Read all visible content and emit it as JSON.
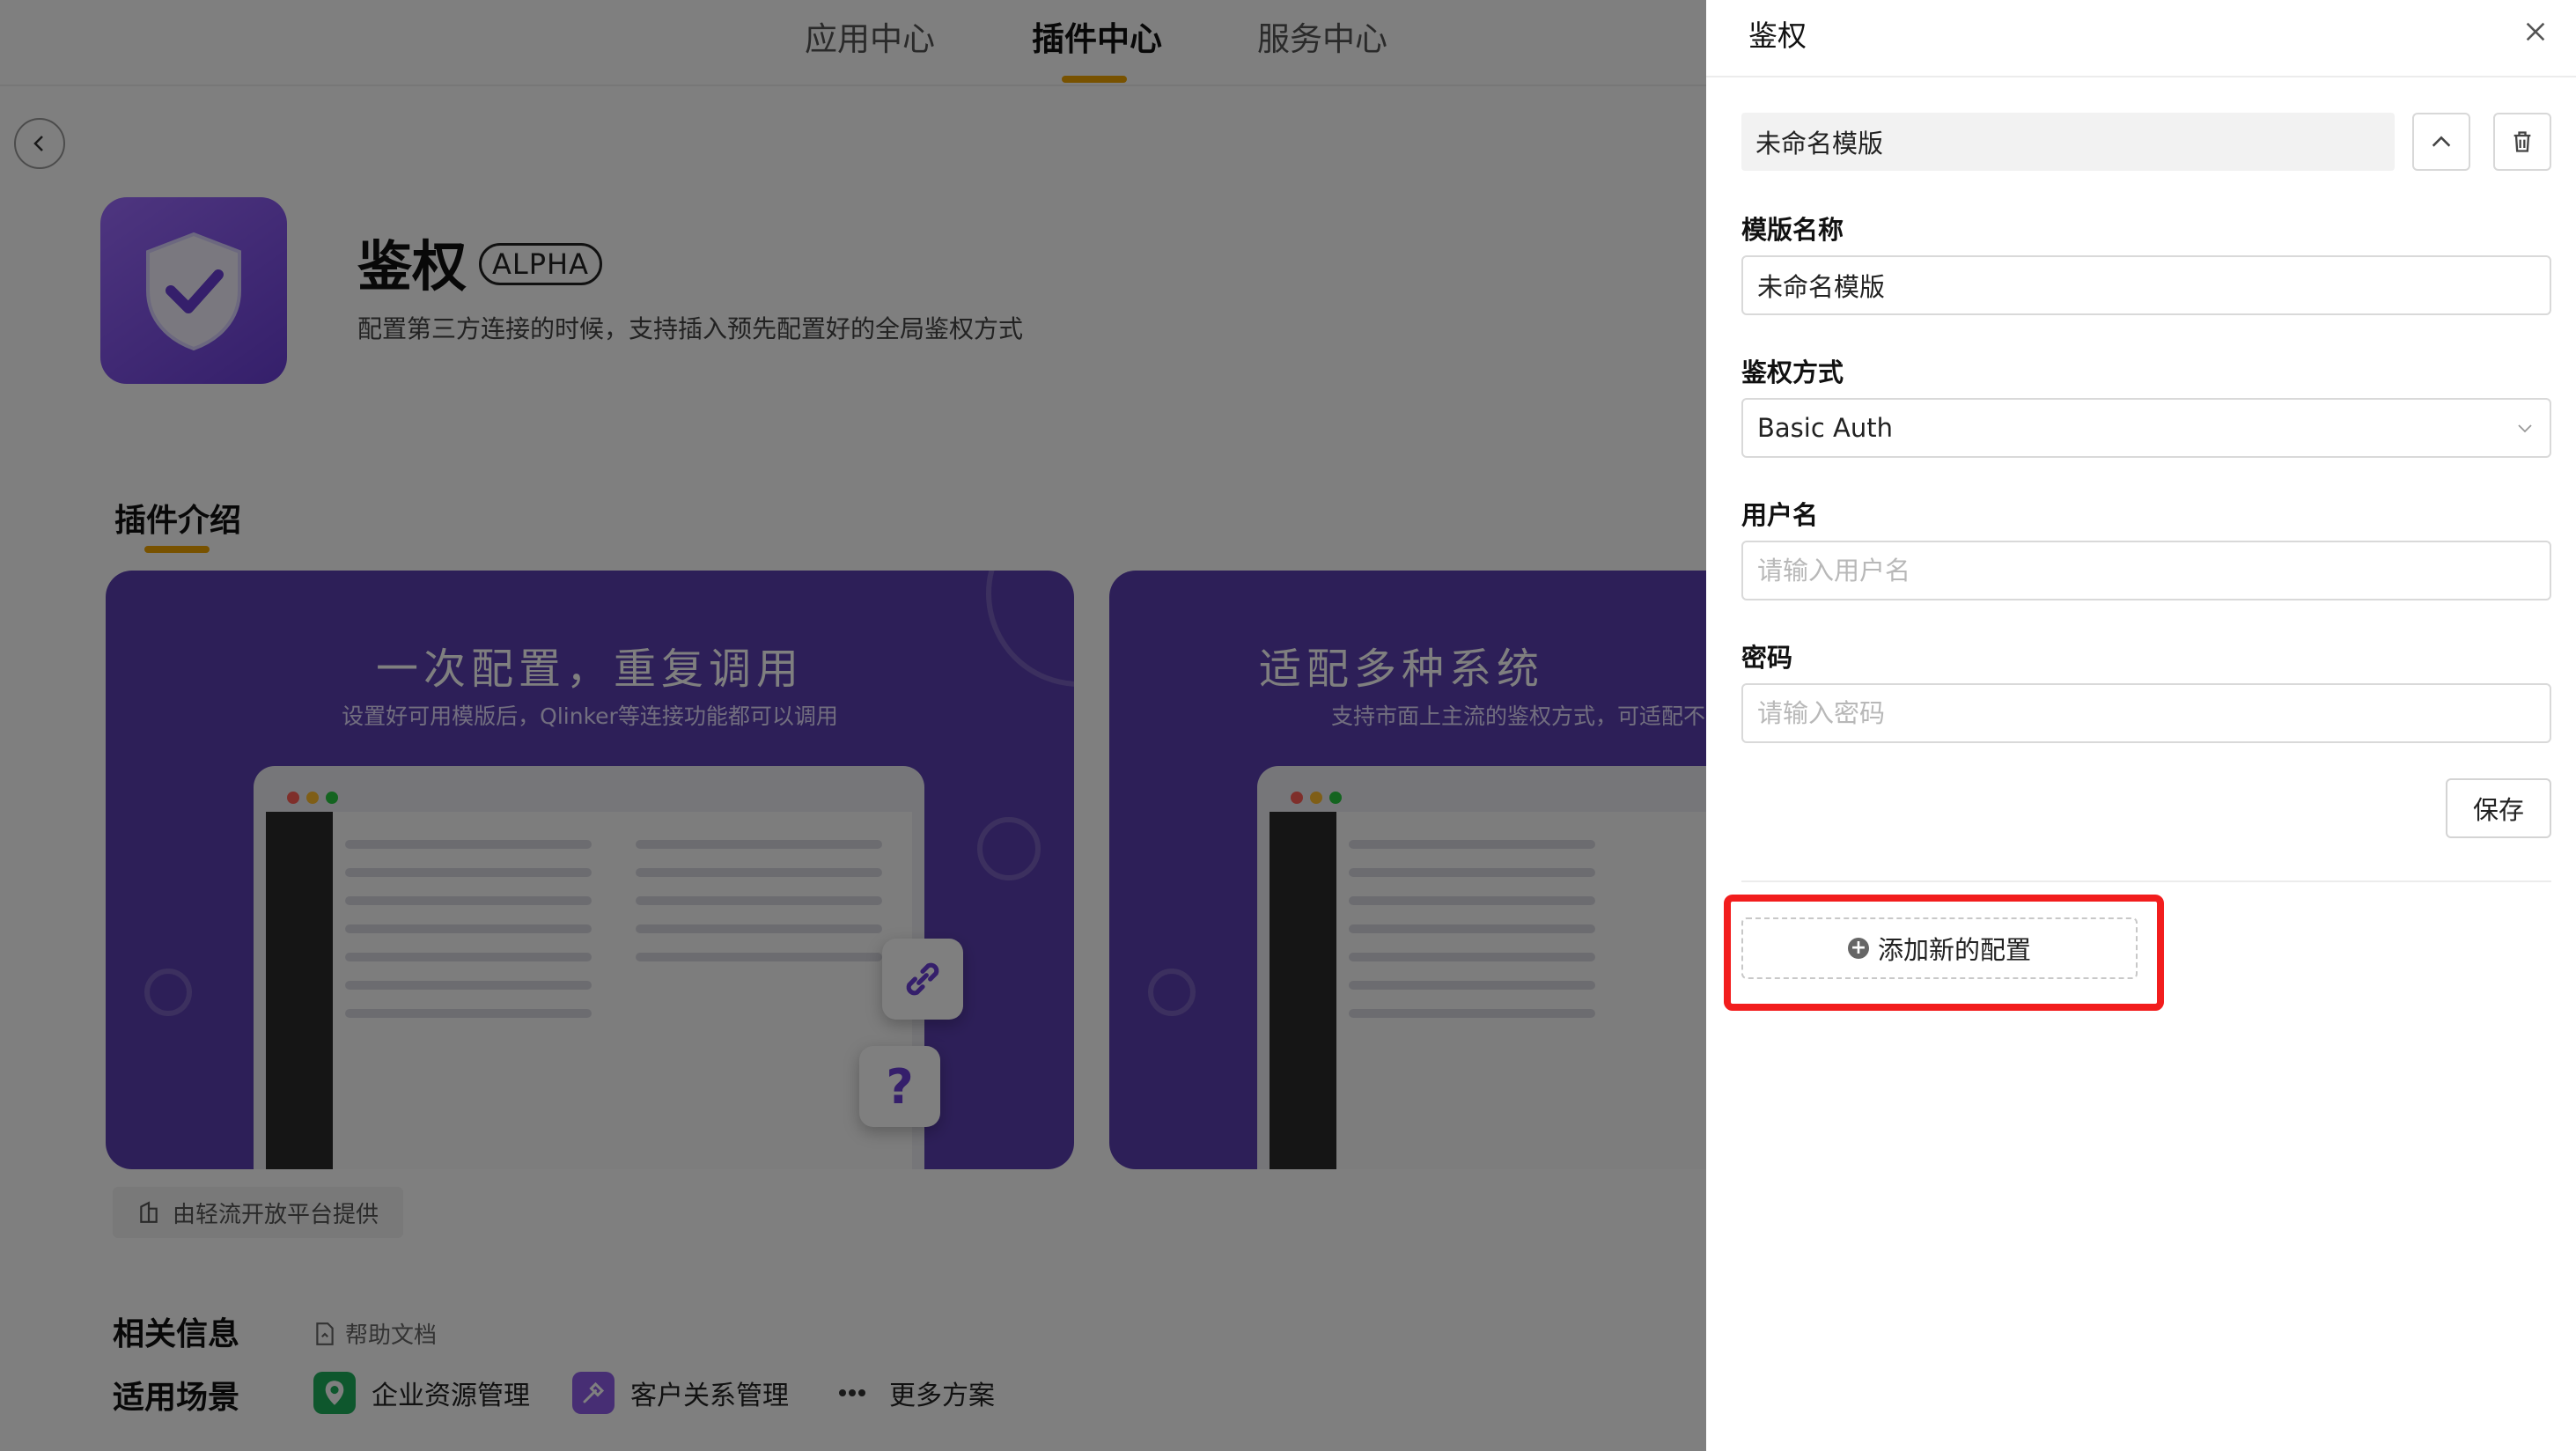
{
  "topnav": {
    "tabs": [
      {
        "label": "应用中心"
      },
      {
        "label": "插件中心"
      },
      {
        "label": "服务中心"
      }
    ]
  },
  "plugin": {
    "title": "鉴权",
    "badge": "ALPHA",
    "description": "配置第三方连接的时候，支持插入预先配置好的全局鉴权方式"
  },
  "intro": {
    "section_title": "插件介绍",
    "cards": [
      {
        "title": "一次配置，重复调用",
        "subtitle": "设置好可用模版后，Qlinker等连接功能都可以调用"
      },
      {
        "title": "适配多种系统",
        "subtitle": "支持市面上主流的鉴权方式，可适配不同"
      }
    ],
    "question_mark": "?"
  },
  "provider": {
    "label": "由轻流开放平台提供"
  },
  "related": {
    "label": "相关信息",
    "help_doc": "帮助文档"
  },
  "scenes": {
    "label": "适用场景",
    "items": [
      {
        "label": "企业资源管理"
      },
      {
        "label": "客户关系管理"
      },
      {
        "label": "更多方案"
      }
    ]
  },
  "drawer": {
    "title": "鉴权",
    "template_name_display": "未命名模版",
    "fields": {
      "template_name": {
        "label": "模版名称",
        "value": "未命名模版"
      },
      "auth_method": {
        "label": "鉴权方式",
        "value": "Basic Auth"
      },
      "username": {
        "label": "用户名",
        "placeholder": "请输入用户名"
      },
      "password": {
        "label": "密码",
        "placeholder": "请输入密码"
      }
    },
    "save_label": "保存",
    "add_config_label": "添加新的配置"
  },
  "colors": {
    "accent": "#f1a400",
    "highlight": "#f21d1d",
    "card_purple": "#5b3fb1"
  }
}
